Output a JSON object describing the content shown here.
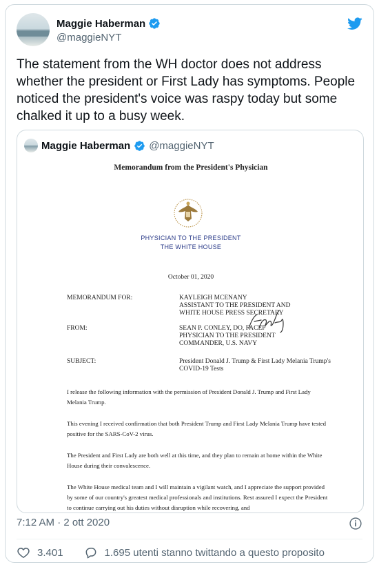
{
  "author": {
    "name": "Maggie Haberman",
    "handle": "@maggieNYT"
  },
  "tweet": {
    "text": "The statement from the WH doctor does not address whether the president or First Lady has symptoms. People noticed the president's voice was raspy today but some chalked it up to a busy week."
  },
  "quoted": {
    "name": "Maggie Haberman",
    "handle": "@maggieNYT",
    "memo": {
      "title": "Memorandum from the President's Physician",
      "office_line1": "PHYSICIAN TO THE PRESIDENT",
      "office_line2": "THE WHITE HOUSE",
      "date": "October 01, 2020",
      "fields": [
        {
          "label": "MEMORANDUM FOR:",
          "lines": [
            "KAYLEIGH MCENANY",
            "ASSISTANT TO THE PRESIDENT AND",
            "WHITE HOUSE PRESS SECRETARY"
          ]
        },
        {
          "label": "FROM:",
          "lines": [
            "SEAN P. CONLEY, DO, FACEP",
            "PHYSICIAN TO THE PRESIDENT",
            "COMMANDER, U.S. NAVY"
          ]
        },
        {
          "label": "SUBJECT:",
          "lines": [
            "President Donald J. Trump & First Lady Melania Trump's",
            "COVID-19 Tests"
          ]
        }
      ],
      "paragraphs": [
        "I release the following information with the permission of President Donald J. Trump and First Lady Melania Trump.",
        "This evening I received confirmation that both President Trump and First Lady Melania Trump have tested positive for the SARS-CoV-2 virus.",
        "The President and First Lady are both well at this time, and they plan to remain at home within the White House during their convalescence.",
        "The White House medical team and I will maintain a vigilant watch, and I appreciate the support provided by some of our country's greatest medical professionals and institutions.  Rest assured I expect the President to continue carrying out his duties without disruption while recovering, and"
      ]
    }
  },
  "meta": {
    "timestamp": "7:12 AM · 2 ott 2020"
  },
  "actions": {
    "likes": "3.401",
    "conversation": "1.695 utenti stanno twittando a questo proposito"
  },
  "colors": {
    "brand_blue": "#1d9bf0",
    "text_secondary": "#536471",
    "border": "#cfd9de"
  }
}
